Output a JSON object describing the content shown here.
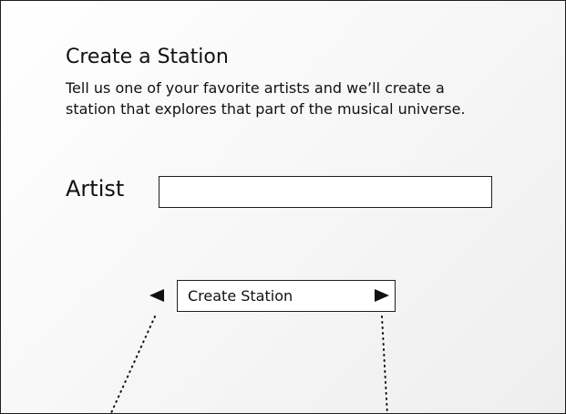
{
  "dialog": {
    "title": "Create a Station",
    "description": "Tell us one of your favorite artists and we’ll create a station that explores that part of the musical universe."
  },
  "form": {
    "artist_label": "Artist",
    "artist_value": "",
    "artist_placeholder": ""
  },
  "actions": {
    "create_label": "Create Station",
    "prev_icon": "triangle-left-icon",
    "next_icon": "triangle-right-icon"
  },
  "colors": {
    "border": "#1f1f1f",
    "text": "#111111",
    "background": "#ffffff"
  }
}
